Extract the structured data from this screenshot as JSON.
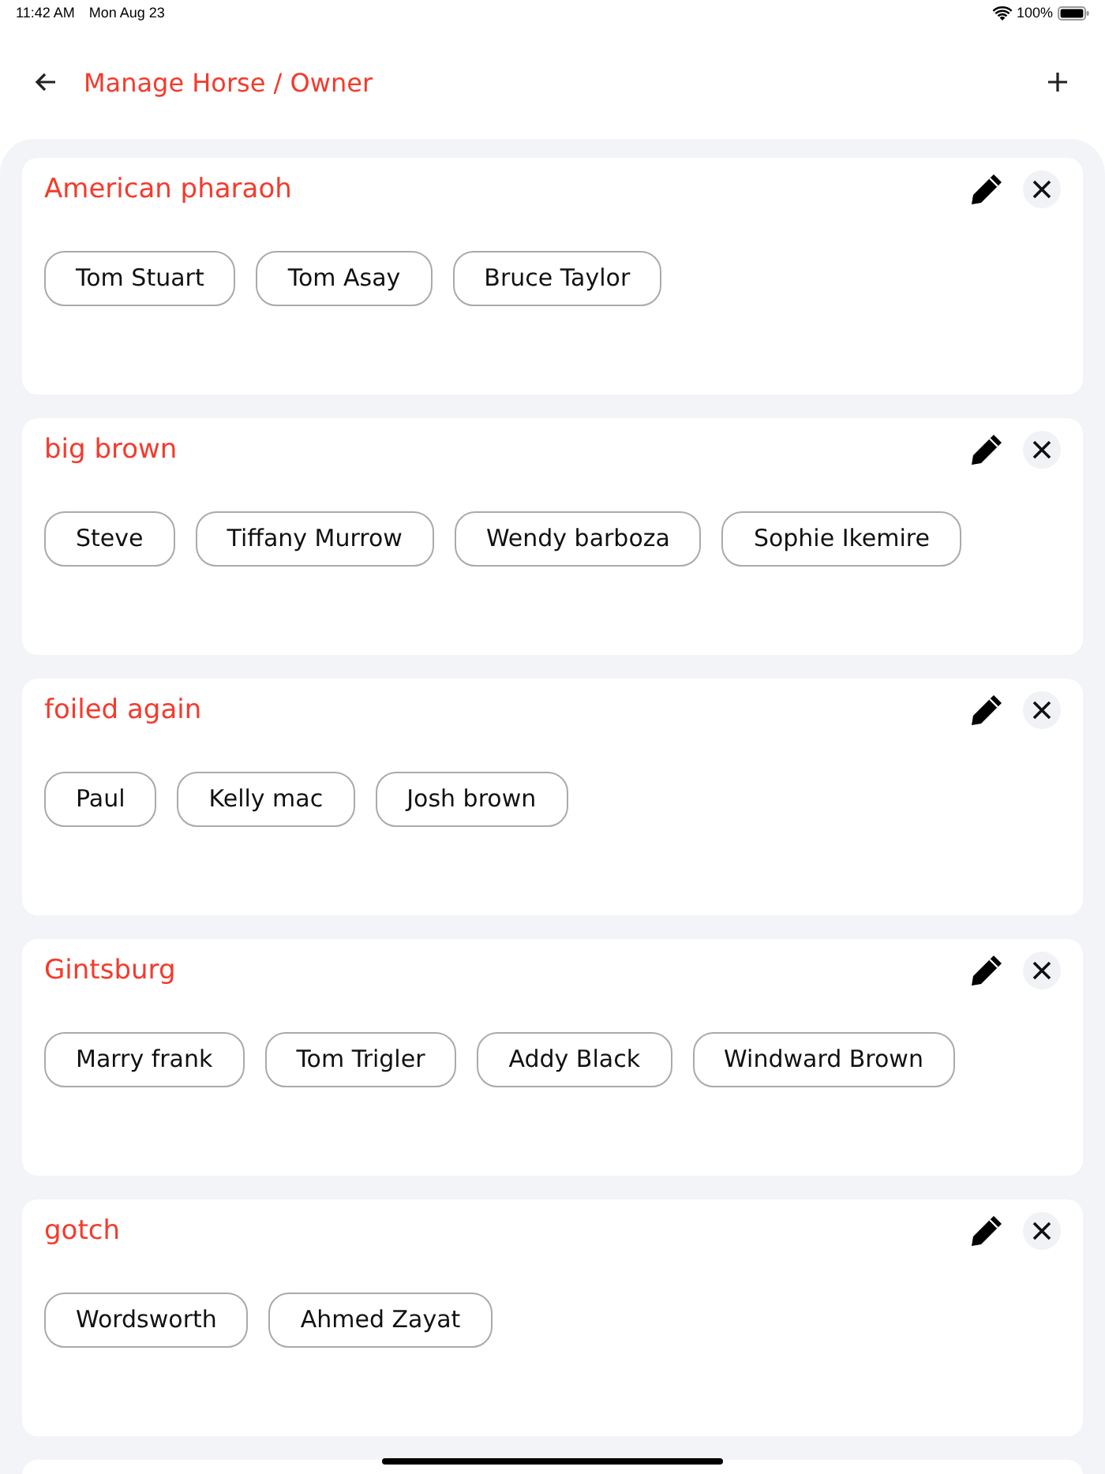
{
  "status_bar": {
    "time": "11:42 AM",
    "date": "Mon Aug 23",
    "battery": "100%"
  },
  "header": {
    "title": "Manage Horse / Owner"
  },
  "horses": [
    {
      "name": "American pharaoh",
      "owners": [
        "Tom Stuart",
        "Tom Asay",
        "Bruce Taylor"
      ]
    },
    {
      "name": "big brown",
      "owners": [
        "Steve",
        "Tiffany Murrow",
        "Wendy barboza",
        "Sophie Ikemire"
      ]
    },
    {
      "name": "foiled again",
      "owners": [
        "Paul",
        "Kelly mac",
        "Josh brown"
      ]
    },
    {
      "name": "Gintsburg",
      "owners": [
        "Marry frank",
        "Tom Trigler",
        "Addy Black",
        "Windward Brown"
      ]
    },
    {
      "name": "gotch",
      "owners": [
        "Wordsworth",
        "Ahmed Zayat"
      ]
    }
  ]
}
